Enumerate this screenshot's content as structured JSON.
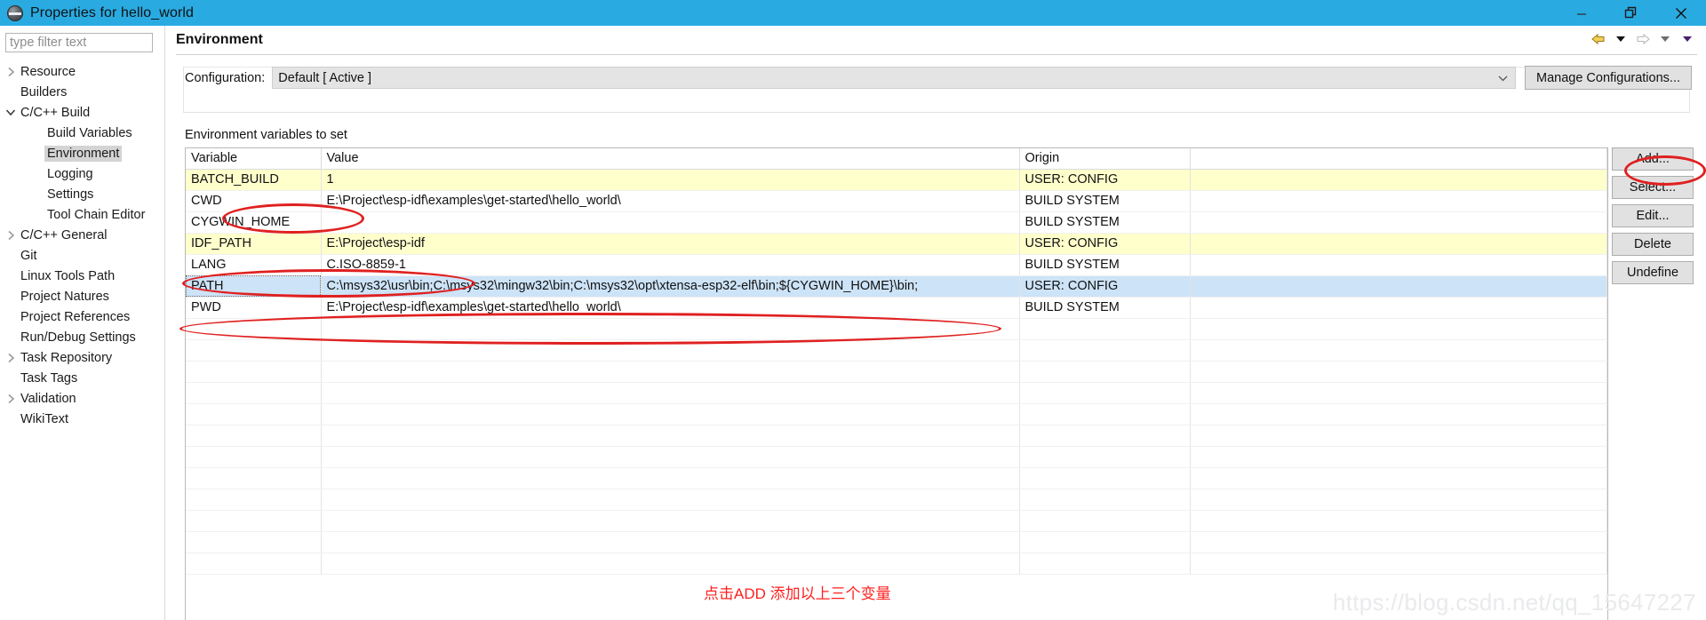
{
  "window": {
    "title": "Properties for hello_world",
    "icon": "eclipse-properties-icon",
    "minimize_label": "minimize-icon",
    "restore_label": "restore-icon",
    "close_label": "close-icon",
    "titlebar_color": "#29ABE2"
  },
  "sidebar": {
    "filter": {
      "value": "",
      "placeholder": "type filter text"
    },
    "items": [
      {
        "label": "Resource",
        "level": 0,
        "arrow": "right",
        "selected": false
      },
      {
        "label": "Builders",
        "level": 0,
        "arrow": "none",
        "selected": false
      },
      {
        "label": "C/C++ Build",
        "level": 0,
        "arrow": "down",
        "selected": false
      },
      {
        "label": "Build Variables",
        "level": 1,
        "arrow": "none",
        "selected": false
      },
      {
        "label": "Environment",
        "level": 1,
        "arrow": "none",
        "selected": true
      },
      {
        "label": "Logging",
        "level": 1,
        "arrow": "none",
        "selected": false
      },
      {
        "label": "Settings",
        "level": 1,
        "arrow": "none",
        "selected": false
      },
      {
        "label": "Tool Chain Editor",
        "level": 1,
        "arrow": "none",
        "selected": false
      },
      {
        "label": "C/C++ General",
        "level": 0,
        "arrow": "right",
        "selected": false
      },
      {
        "label": "Git",
        "level": 0,
        "arrow": "none",
        "selected": false
      },
      {
        "label": "Linux Tools Path",
        "level": 0,
        "arrow": "none",
        "selected": false
      },
      {
        "label": "Project Natures",
        "level": 0,
        "arrow": "none",
        "selected": false
      },
      {
        "label": "Project References",
        "level": 0,
        "arrow": "none",
        "selected": false
      },
      {
        "label": "Run/Debug Settings",
        "level": 0,
        "arrow": "none",
        "selected": false
      },
      {
        "label": "Task Repository",
        "level": 0,
        "arrow": "right",
        "selected": false
      },
      {
        "label": "Task Tags",
        "level": 0,
        "arrow": "none",
        "selected": false
      },
      {
        "label": "Validation",
        "level": 0,
        "arrow": "right",
        "selected": false
      },
      {
        "label": "WikiText",
        "level": 0,
        "arrow": "none",
        "selected": false
      }
    ]
  },
  "page": {
    "title": "Environment",
    "nav_icons": [
      "back-arrow-icon",
      "back-dropdown-icon",
      "forward-arrow-icon",
      "forward-dropdown-icon",
      "menu-dropdown-icon"
    ]
  },
  "configuration": {
    "label": "Configuration:",
    "value": "Default  [ Active ]",
    "manage_button": "Manage Configurations..."
  },
  "table": {
    "caption": "Environment variables to set",
    "columns": [
      "Variable",
      "Value",
      "Origin",
      ""
    ],
    "rows": [
      {
        "variable": "BATCH_BUILD",
        "value": "1",
        "origin": "USER: CONFIG",
        "state": "highlight"
      },
      {
        "variable": "CWD",
        "value": "E:\\Project\\esp-idf\\examples\\get-started\\hello_world\\",
        "origin": "BUILD SYSTEM",
        "state": "normal"
      },
      {
        "variable": "CYGWIN_HOME",
        "value": "",
        "origin": "BUILD SYSTEM",
        "state": "normal"
      },
      {
        "variable": "IDF_PATH",
        "value": "E:\\Project\\esp-idf",
        "origin": "USER: CONFIG",
        "state": "highlight"
      },
      {
        "variable": "LANG",
        "value": "C.ISO-8859-1",
        "origin": "BUILD SYSTEM",
        "state": "normal"
      },
      {
        "variable": "PATH",
        "value": "C:\\msys32\\usr\\bin;C:\\msys32\\mingw32\\bin;C:\\msys32\\opt\\xtensa-esp32-elf\\bin;${CYGWIN_HOME}\\bin;",
        "origin": "USER: CONFIG",
        "state": "selected"
      },
      {
        "variable": "PWD",
        "value": "E:\\Project\\esp-idf\\examples\\get-started\\hello_world\\",
        "origin": "BUILD SYSTEM",
        "state": "normal"
      }
    ],
    "empty_row_count": 12
  },
  "buttons": [
    {
      "label": "Add...",
      "name": "add-button"
    },
    {
      "label": "Select...",
      "name": "select-button"
    },
    {
      "label": "Edit...",
      "name": "edit-button"
    },
    {
      "label": "Delete",
      "name": "delete-button"
    },
    {
      "label": "Undefine",
      "name": "undefine-button"
    }
  ],
  "annotations": {
    "note_text": "点击ADD 添加以上三个变量",
    "note_color": "#ff2020",
    "ellipse_color": "#e02020",
    "watermark": "https://blog.csdn.net/qq_15647227"
  }
}
